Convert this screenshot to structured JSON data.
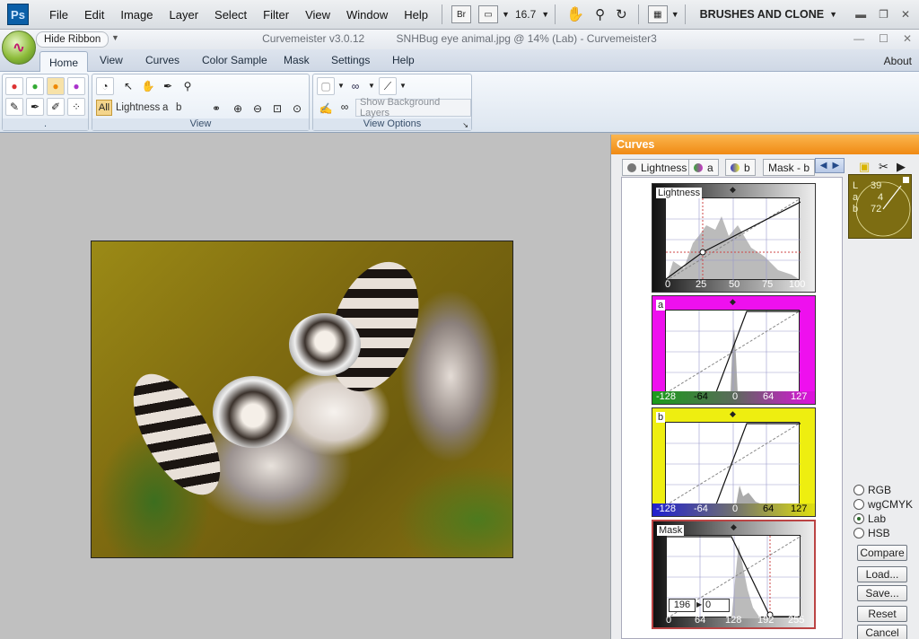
{
  "photoshop": {
    "logo": "Ps",
    "menu": [
      "File",
      "Edit",
      "Image",
      "Layer",
      "Select",
      "Filter",
      "View",
      "Window",
      "Help"
    ],
    "bridge": "Br",
    "zoom": "16.7",
    "workspace": "BRUSHES AND CLONE"
  },
  "titlebar": {
    "hide_ribbon": "Hide Ribbon",
    "app": "Curvemeister v3.0.12",
    "document": "SNHBug eye animal.jpg @ 14% (Lab) - Curvemeister3"
  },
  "tabs": [
    "Home",
    "View",
    "Curves",
    "Color Sample",
    "Mask",
    "Settings",
    "Help"
  ],
  "about": "About",
  "ribbon": {
    "group1_label": ".",
    "all": "All",
    "lightness": "Lightness",
    "a": "a",
    "b": "b",
    "group2_label": "View",
    "show_bg": "Show Background Layers",
    "group3_label": "View Options"
  },
  "curves_panel": {
    "title": "Curves",
    "tabs": [
      "Lightness",
      "a",
      "b",
      "Mask - b"
    ],
    "graphs": [
      {
        "name": "Lightness",
        "ticks": [
          "0",
          "25",
          "50",
          "75",
          "100"
        ]
      },
      {
        "name": "a",
        "ticks": [
          "-128",
          "-64",
          "0",
          "64",
          "127"
        ]
      },
      {
        "name": "b",
        "ticks": [
          "-128",
          "-64",
          "0",
          "64",
          "127"
        ]
      },
      {
        "name": "Mask",
        "ticks": [
          "0",
          "64",
          "128",
          "192",
          "255"
        ],
        "input": "196",
        "output": "0"
      }
    ],
    "readout": {
      "L_label": "L",
      "L": "39",
      "a_label": "a",
      "a": "4",
      "b_label": "b",
      "b": "72"
    },
    "color_modes": [
      "RGB",
      "wgCMYK",
      "Lab",
      "HSB"
    ],
    "selected_mode": "Lab",
    "buttons": [
      "Compare",
      "Load...",
      "Save...",
      "Reset",
      "Cancel"
    ]
  }
}
